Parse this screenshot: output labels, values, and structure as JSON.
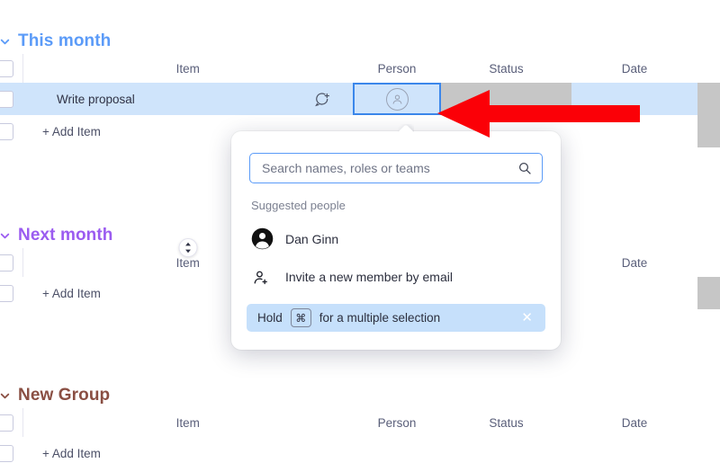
{
  "board": {
    "columns": [
      "Item",
      "Person",
      "Status",
      "Date"
    ],
    "add_item_label": "+ Add Item",
    "groups": [
      {
        "name": "This month",
        "color": "#5b9bf8",
        "collapse_icon": "chevron-down-icon",
        "rows": [
          {
            "item": "Write proposal",
            "person": "",
            "status": "",
            "date": "",
            "selected": true,
            "has_comment": true
          }
        ]
      },
      {
        "name": "Next month",
        "color": "#9b5cf0",
        "collapse_icon": "chevron-down-icon",
        "rows": []
      },
      {
        "name": "New Group",
        "color": "#8a4f43",
        "collapse_icon": "chevron-down-icon",
        "rows": []
      }
    ]
  },
  "person_picker": {
    "search": {
      "placeholder": "Search names, roles or teams",
      "value": "",
      "icon": "search-icon"
    },
    "suggested_label": "Suggested people",
    "people": [
      {
        "name": "Dan Ginn",
        "icon": "avatar-icon"
      }
    ],
    "invite": {
      "label": "Invite a new member by email",
      "icon": "person-add-icon"
    },
    "hint": {
      "prefix": "Hold",
      "key": "⌘",
      "suffix": "for a multiple selection",
      "close_icon": "close-icon"
    }
  },
  "annotation": {
    "arrow_color": "#fb0007",
    "icon": "left-arrow-annotation"
  },
  "colors": {
    "selected_row": "#cfe4fb",
    "empty_status": "#c6c6c6",
    "grid_line": "#e6e6f0",
    "accent_blue": "#3b87eb",
    "hint_bg": "#c6e0fb"
  }
}
